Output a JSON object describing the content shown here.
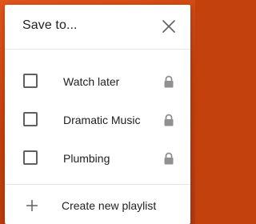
{
  "dialog": {
    "title": "Save to...",
    "close_icon": "close-icon"
  },
  "playlists": [
    {
      "label": "Watch later",
      "checked": false,
      "icon": "lock-icon"
    },
    {
      "label": "Dramatic Music",
      "checked": false,
      "icon": "lock-icon"
    },
    {
      "label": "Plumbing",
      "checked": false,
      "icon": "lock-icon"
    }
  ],
  "create": {
    "label": "Create new playlist",
    "icon": "plus-icon"
  },
  "colors": {
    "backdrop": "#c8400c",
    "text": "#212121",
    "icon": "#909090",
    "checkbox_border": "#606060",
    "divider": "#e5e5e5"
  }
}
